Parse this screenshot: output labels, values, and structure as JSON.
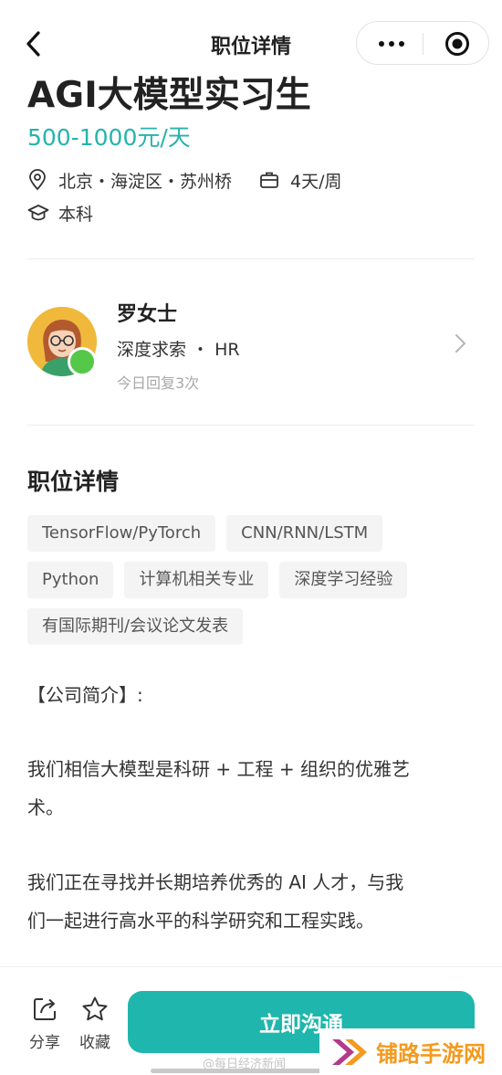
{
  "navbar": {
    "title": "职位详情"
  },
  "job": {
    "title": "AGI大模型实习生",
    "salary": "500-1000元/天",
    "location": "北京・海淀区・苏州桥",
    "schedule": "4天/周",
    "education": "本科"
  },
  "recruiter": {
    "name": "罗女士",
    "company_role": "深度求索 ・ HR",
    "activity": "今日回复3次"
  },
  "details": {
    "section_title": "职位详情",
    "tags": [
      [
        "TensorFlow/PyTorch",
        "CNN/RNN/LSTM"
      ],
      [
        "Python",
        "计算机相关专业",
        "深度学习经验"
      ],
      [
        "有国际期刊/会议论文发表"
      ]
    ],
    "intro_heading": "【公司简介】:",
    "paragraph1_line1": "我们相信大模型是科研 + 工程 + 组织的优雅艺",
    "paragraph1_line2": "术。",
    "paragraph2_line1": "我们正在寻找并长期培养优秀的 AI 人才，与我",
    "paragraph2_line2": "们一起进行高水平的科学研究和工程实践。"
  },
  "bottom_bar": {
    "share_label": "分享",
    "favorite_label": "收藏",
    "chat_button_label": "立即沟通"
  },
  "watermarks": {
    "weibo": "@每日经济新闻",
    "site": "铺路手游网"
  },
  "colors": {
    "accent": "#1fb7ad",
    "salary": "#26b3ab",
    "online": "#55c84a",
    "watermark": "#f39a1f"
  },
  "icons": [
    "back-chevron-icon",
    "more-icon",
    "target-icon",
    "location-pin-icon",
    "briefcase-icon",
    "graduation-cap-icon",
    "chevron-right-icon",
    "share-icon",
    "star-icon"
  ]
}
